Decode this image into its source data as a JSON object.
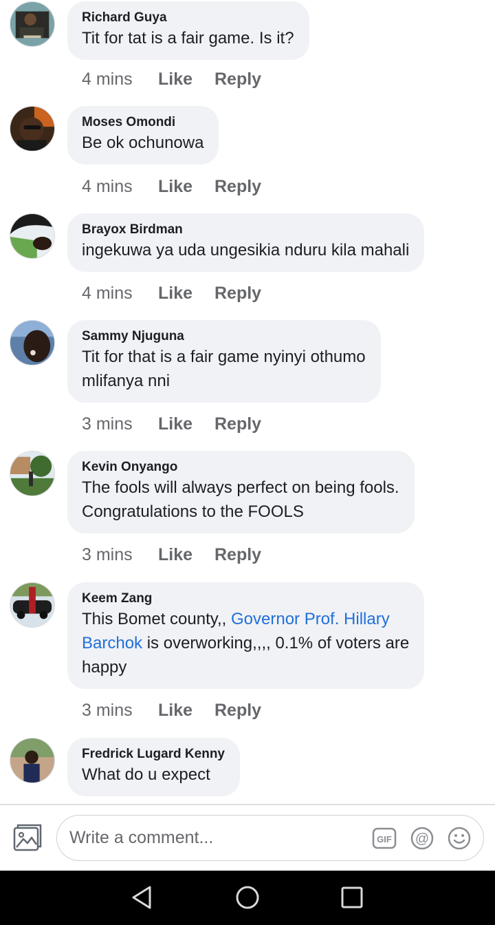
{
  "comments": [
    {
      "author": "Richard Guya",
      "text": "Tit for tat is a fair game. Is it?",
      "time": "4 mins",
      "like": "Like",
      "reply": "Reply"
    },
    {
      "author": "Moses Omondi",
      "text": "Be ok ochunowa",
      "time": "4 mins",
      "like": "Like",
      "reply": "Reply"
    },
    {
      "author": "Brayox Birdman",
      "text": "ingekuwa ya uda ungesikia nduru kila mahali",
      "time": "4 mins",
      "like": "Like",
      "reply": "Reply"
    },
    {
      "author": "Sammy Njuguna",
      "line1": "Tit for that is a fair game nyinyi othumo",
      "line2": "mlifanya nni",
      "time": "3 mins",
      "like": "Like",
      "reply": "Reply"
    },
    {
      "author": "Kevin Onyango",
      "line1": "The fools will always perfect on being fools.",
      "line2": "Congratulations to the FOOLS",
      "time": "3 mins",
      "like": "Like",
      "reply": "Reply"
    },
    {
      "author": "Keem Zang",
      "text_before": "This Bomet county,, ",
      "mention_part1": "Governor Prof. Hillary",
      "mention_part2": "Barchok",
      "text_after": " is overworking,,,, 0.1% of voters are",
      "line3": "happy",
      "time": "3 mins",
      "like": "Like",
      "reply": "Reply"
    },
    {
      "author": "Fredrick Lugard Kenny",
      "text": "What do u expect"
    }
  ],
  "composer": {
    "placeholder": "Write a comment...",
    "photo_icon": "photo-icon",
    "gif_icon": "gif-icon",
    "mention_icon": "at-icon",
    "emoji_icon": "smiley-icon"
  },
  "navbar": {
    "back_icon": "back-triangle-icon",
    "home_icon": "home-circle-icon",
    "recents_icon": "recents-square-icon"
  },
  "colors": {
    "bubble": "#f0f2f5",
    "link": "#216fdb",
    "meta": "#65676b"
  }
}
